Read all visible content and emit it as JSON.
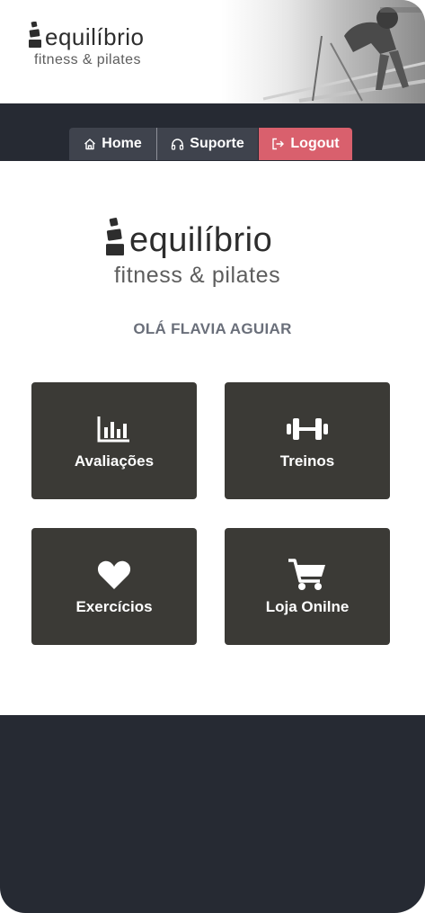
{
  "brand": {
    "wordmark": "equilíbrio",
    "tagline": "fitness & pilates"
  },
  "nav": {
    "home": {
      "label": "Home",
      "icon": "home-icon"
    },
    "support": {
      "label": "Suporte",
      "icon": "headphones-icon"
    },
    "logout": {
      "label": "Logout",
      "icon": "logout-icon"
    }
  },
  "greeting": "OLÁ FLAVIA AGUIAR",
  "tiles": [
    {
      "label": "Avaliações",
      "icon": "bar-chart-icon"
    },
    {
      "label": "Treinos",
      "icon": "dumbbell-icon"
    },
    {
      "label": "Exercícios",
      "icon": "heart-icon"
    },
    {
      "label": "Loja Onilne",
      "icon": "shopping-cart-icon"
    }
  ],
  "colors": {
    "dark_band": "#262a33",
    "tile": "#3b3a36",
    "logout": "#d9606d",
    "nav_button": "#3f434d",
    "greeting_text": "#6a6f7a"
  }
}
